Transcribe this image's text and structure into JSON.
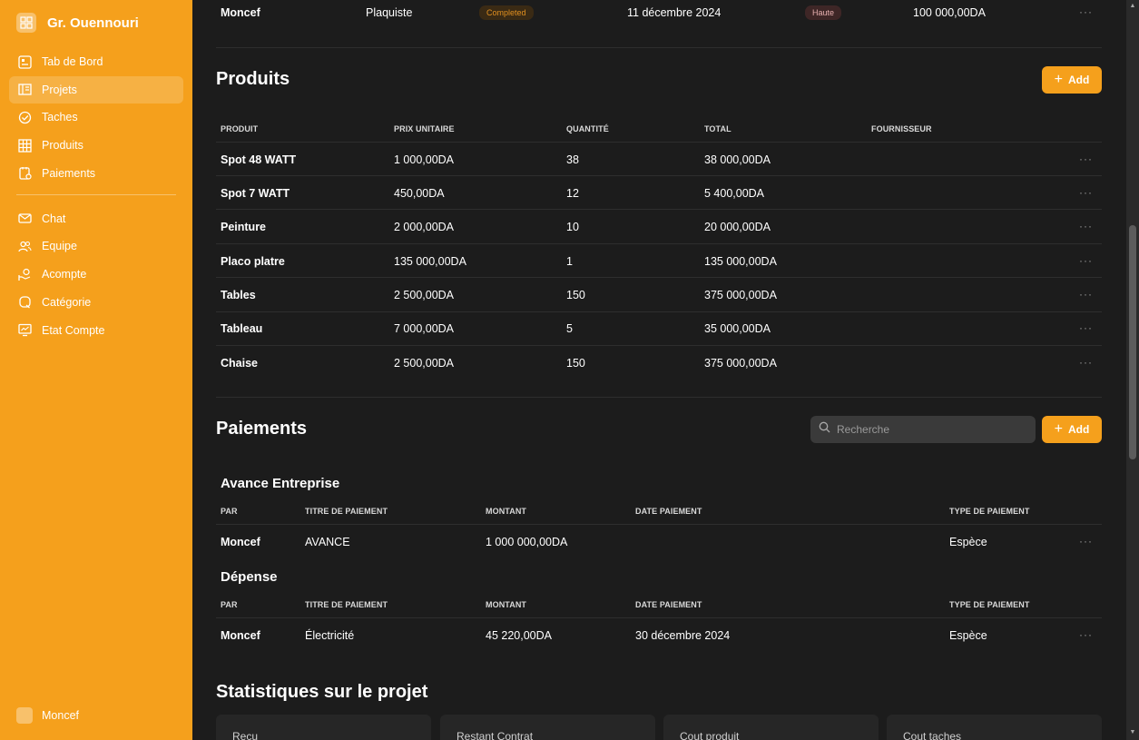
{
  "brand": {
    "name": "Gr. Ouennouri"
  },
  "nav": [
    {
      "label": "Tab de Bord",
      "icon": "dashboard-icon"
    },
    {
      "label": "Projets",
      "icon": "building-icon",
      "active": true
    },
    {
      "label": "Taches",
      "icon": "check-circle-icon"
    },
    {
      "label": "Produits",
      "icon": "grid-icon"
    },
    {
      "label": "Paiements",
      "icon": "clipboard-icon"
    },
    {
      "label": "Chat",
      "icon": "mail-icon"
    },
    {
      "label": "Equipe",
      "icon": "users-icon"
    },
    {
      "label": "Acompte",
      "icon": "hand-coin-icon"
    },
    {
      "label": "Catégorie",
      "icon": "tag-icon"
    },
    {
      "label": "Etat Compte",
      "icon": "monitor-icon"
    }
  ],
  "user": {
    "name": "Moncef"
  },
  "top_row": {
    "name": "Moncef",
    "role": "Plaquiste",
    "status": "Completed",
    "date": "11 décembre 2024",
    "priority": "Haute",
    "amount": "100 000,00DA"
  },
  "produits": {
    "title": "Produits",
    "add_label": "Add",
    "headers": [
      "PRODUIT",
      "PRIX UNITAIRE",
      "QUANTITÉ",
      "TOTAL",
      "FOURNISSEUR"
    ],
    "rows": [
      [
        "Spot 48 WATT",
        "1 000,00DA",
        "38",
        "38 000,00DA",
        ""
      ],
      [
        "Spot 7 WATT",
        "450,00DA",
        "12",
        "5 400,00DA",
        ""
      ],
      [
        "Peinture",
        "2 000,00DA",
        "10",
        "20 000,00DA",
        ""
      ],
      [
        "Placo platre",
        "135 000,00DA",
        "1",
        "135 000,00DA",
        ""
      ],
      [
        "Tables",
        "2 500,00DA",
        "150",
        "375 000,00DA",
        ""
      ],
      [
        "Tableau",
        "7 000,00DA",
        "5",
        "35 000,00DA",
        ""
      ],
      [
        "Chaise",
        "2 500,00DA",
        "150",
        "375 000,00DA",
        ""
      ]
    ]
  },
  "paiements": {
    "title": "Paiements",
    "search_placeholder": "Recherche",
    "add_label": "Add",
    "headers": [
      "PAR",
      "TITRE DE PAIEMENT",
      "MONTANT",
      "DATE PAIEMENT",
      "TYPE DE PAIEMENT"
    ],
    "groups": [
      {
        "title": "Avance Entreprise",
        "rows": [
          [
            "Moncef",
            "AVANCE",
            "1 000 000,00DA",
            "",
            "Espèce"
          ]
        ]
      },
      {
        "title": "Dépense",
        "rows": [
          [
            "Moncef",
            "Électricité",
            "45 220,00DA",
            "30 décembre 2024",
            "Espèce"
          ]
        ]
      }
    ]
  },
  "stats": {
    "title": "Statistiques sur le projet",
    "cards": [
      "Reçu",
      "Restant Contrat",
      "Cout produit",
      "Cout taches"
    ]
  },
  "colors": {
    "accent": "#f5a01c",
    "background": "#1c1c1c"
  }
}
